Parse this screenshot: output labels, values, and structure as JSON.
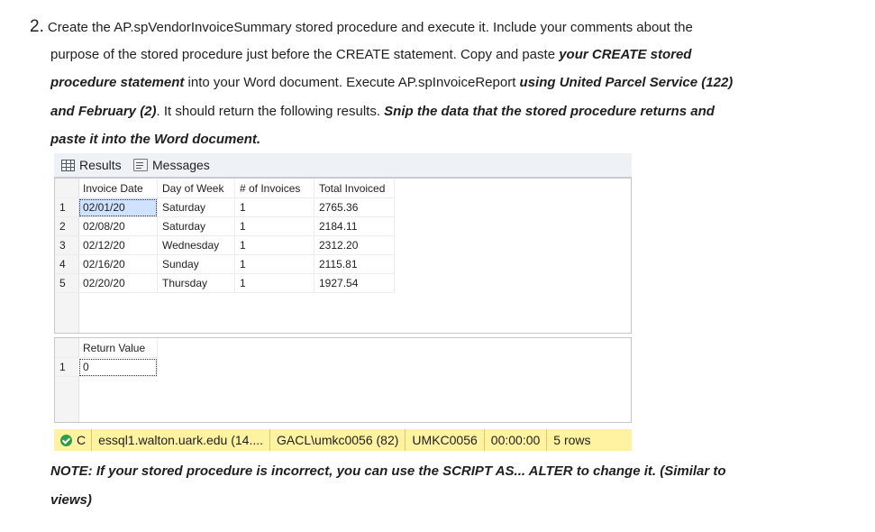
{
  "instructions": {
    "number": "2.",
    "line1": "Create the AP.spVendorInvoiceSummary stored procedure and execute it.  Include your comments about the",
    "line2_a": "purpose of the stored procedure just before the CREATE statement.  Copy and paste ",
    "line2_b": "your CREATE  stored",
    "line3_a": "procedure statement",
    "line3_b": " into your Word document.  Execute AP.spInvoiceReport ",
    "line3_c": "using United Parcel Service (122)",
    "line4_a": "and February (2)",
    "line4_b": ".  It should return the following results.  ",
    "line4_c": "Snip the data that the stored procedure returns and",
    "line5": "paste it into the Word document."
  },
  "tabs": {
    "results": "Results",
    "messages": "Messages"
  },
  "results_grid": {
    "columns": [
      "Invoice Date",
      "Day of Week",
      "# of Invoices",
      "Total Invoiced"
    ],
    "rows": [
      {
        "n": "1",
        "date": "02/01/20",
        "day": "Saturday",
        "count": "1",
        "total": "2765.36"
      },
      {
        "n": "2",
        "date": "02/08/20",
        "day": "Saturday",
        "count": "1",
        "total": "2184.11"
      },
      {
        "n": "3",
        "date": "02/12/20",
        "day": "Wednesday",
        "count": "1",
        "total": "2312.20"
      },
      {
        "n": "4",
        "date": "02/16/20",
        "day": "Sunday",
        "count": "1",
        "total": "2115.81"
      },
      {
        "n": "5",
        "date": "02/20/20",
        "day": "Thursday",
        "count": "1",
        "total": "1927.54"
      }
    ]
  },
  "return_grid": {
    "column": "Return Value",
    "row_num": "1",
    "value": "0"
  },
  "status_bar": {
    "state_letter": "C",
    "server": "essql1.walton.uark.edu (14....",
    "user": "GACL\\umkc0056 (82)",
    "database": "UMKC0056",
    "elapsed": "00:00:00",
    "rows": "5 rows"
  },
  "note": {
    "line1": "NOTE:  If your stored procedure is incorrect, you can use the SCRIPT AS... ALTER to change it.  (Similar to",
    "line2": "views)"
  }
}
